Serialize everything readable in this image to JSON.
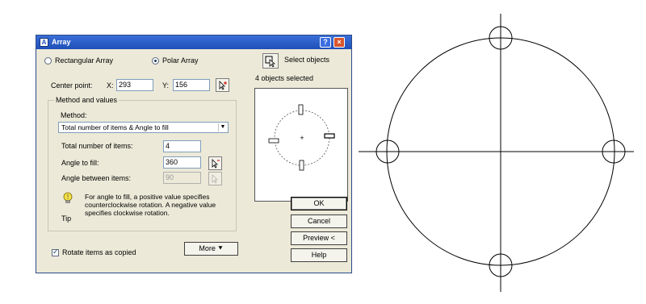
{
  "dialog": {
    "title": "Array",
    "title_icon": "A",
    "help_btn": "?",
    "close_btn": "×",
    "rect_label": "Rectangular Array",
    "polar_label": "Polar Array",
    "select_objects": "Select objects",
    "objects_selected": "4 objects selected",
    "center_point": "Center point:",
    "x_label": "X:",
    "x_value": "293",
    "y_label": "Y:",
    "y_value": "156",
    "method_group": "Method and values",
    "method_label": "Method:",
    "method_value": "Total number of items & Angle to fill",
    "total_items_label": "Total number of items:",
    "total_items_value": "4",
    "angle_fill_label": "Angle to fill:",
    "angle_fill_value": "360",
    "angle_between_label": "Angle between items:",
    "angle_between_value": "90",
    "tip_text": "For angle to fill, a positive value specifies counterclockwise rotation.  A negative value specifies clockwise rotation.",
    "tip_label": "Tip",
    "rotate_label": "Rotate items as copied",
    "more_btn": "More  ⯆",
    "ok_btn": "OK",
    "cancel_btn": "Cancel",
    "preview_btn": "Preview <",
    "help_btn_label": "Help"
  }
}
